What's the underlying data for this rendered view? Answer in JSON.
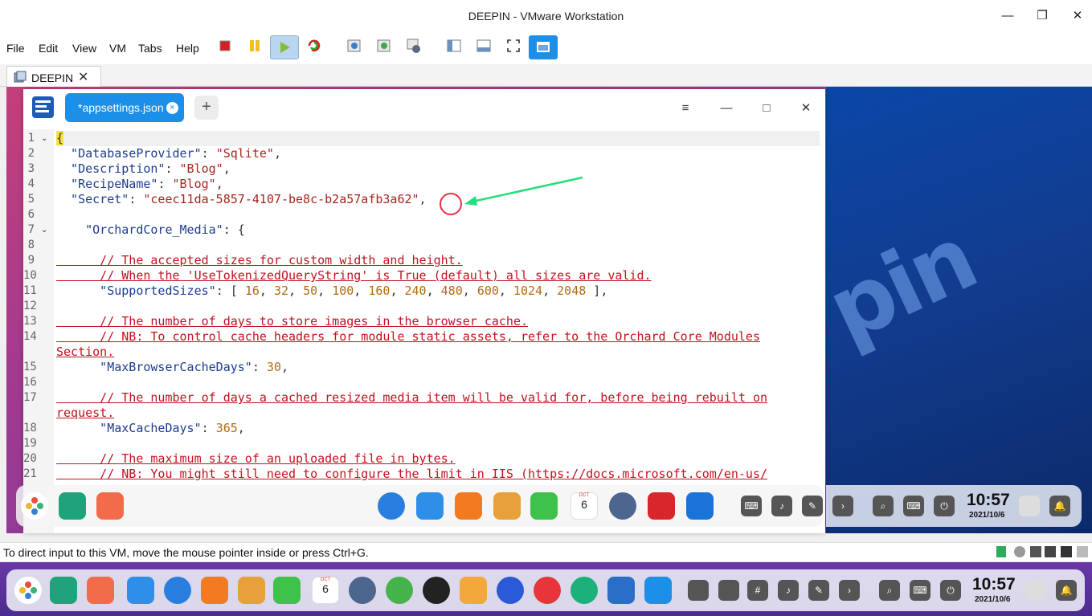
{
  "window": {
    "title": "DEEPIN - VMware Workstation",
    "minimize": "—",
    "restore": "❐",
    "close": "✕"
  },
  "menu": [
    "File",
    "Edit",
    "View",
    "VM",
    "Tabs",
    "Help"
  ],
  "toolbar": {
    "icons": [
      "power-icon",
      "pause-icon",
      "play-icon",
      "restart-icon",
      "snapshot-icon",
      "revert-snapshot-icon",
      "snapshot-manager-icon",
      "sidebar-icon",
      "console-view-icon",
      "fullscreen-icon",
      "unity-icon"
    ]
  },
  "vm_tab": {
    "label": "DEEPIN",
    "close": "✕"
  },
  "editor": {
    "tab_label": "*appsettings.json",
    "tab_close": "×",
    "add_tab": "+",
    "menu": "≡",
    "minimize": "—",
    "maximize": "□",
    "close": "✕",
    "line_numbers": [
      "1",
      "2",
      "3",
      "4",
      "5",
      "6",
      "7",
      "8",
      "9",
      "10",
      "11",
      "12",
      "13",
      "14",
      "",
      "15",
      "16",
      "17",
      "",
      "18",
      "19",
      "20",
      "21"
    ],
    "lines": [
      {
        "parts": [
          {
            "t": "{",
            "c": "p"
          }
        ]
      },
      {
        "parts": [
          {
            "t": "  \"DatabaseProvider\"",
            "c": "k"
          },
          {
            "t": ": ",
            "c": "p"
          },
          {
            "t": "\"Sqlite\"",
            "c": "s"
          },
          {
            "t": ",",
            "c": "p"
          }
        ]
      },
      {
        "parts": [
          {
            "t": "  \"Description\"",
            "c": "k"
          },
          {
            "t": ": ",
            "c": "p"
          },
          {
            "t": "\"Blog\"",
            "c": "s"
          },
          {
            "t": ",",
            "c": "p"
          }
        ]
      },
      {
        "parts": [
          {
            "t": "  \"RecipeName\"",
            "c": "k"
          },
          {
            "t": ": ",
            "c": "p"
          },
          {
            "t": "\"Blog\"",
            "c": "s"
          },
          {
            "t": ",",
            "c": "p"
          }
        ]
      },
      {
        "parts": [
          {
            "t": "  \"Secret\"",
            "c": "k"
          },
          {
            "t": ": ",
            "c": "p"
          },
          {
            "t": "\"ceec11da-5857-4107-be8c-b2a57afb3a62\"",
            "c": "s"
          },
          {
            "t": ",",
            "c": "p"
          }
        ]
      },
      {
        "parts": []
      },
      {
        "parts": [
          {
            "t": "    \"OrchardCore_Media\"",
            "c": "k"
          },
          {
            "t": ": {",
            "c": "p"
          }
        ]
      },
      {
        "parts": []
      },
      {
        "parts": [
          {
            "t": "      // The accepted sizes for custom width and height.",
            "c": "c"
          }
        ]
      },
      {
        "parts": [
          {
            "t": "      // When the 'UseTokenizedQueryString' is True (default) all sizes are valid.",
            "c": "c"
          }
        ]
      },
      {
        "parts": [
          {
            "t": "      \"SupportedSizes\"",
            "c": "k"
          },
          {
            "t": ": [ ",
            "c": "p"
          },
          {
            "t": "16",
            "c": "n"
          },
          {
            "t": ", ",
            "c": "p"
          },
          {
            "t": "32",
            "c": "n"
          },
          {
            "t": ", ",
            "c": "p"
          },
          {
            "t": "50",
            "c": "n"
          },
          {
            "t": ", ",
            "c": "p"
          },
          {
            "t": "100",
            "c": "n"
          },
          {
            "t": ", ",
            "c": "p"
          },
          {
            "t": "160",
            "c": "n"
          },
          {
            "t": ", ",
            "c": "p"
          },
          {
            "t": "240",
            "c": "n"
          },
          {
            "t": ", ",
            "c": "p"
          },
          {
            "t": "480",
            "c": "n"
          },
          {
            "t": ", ",
            "c": "p"
          },
          {
            "t": "600",
            "c": "n"
          },
          {
            "t": ", ",
            "c": "p"
          },
          {
            "t": "1024",
            "c": "n"
          },
          {
            "t": ", ",
            "c": "p"
          },
          {
            "t": "2048",
            "c": "n"
          },
          {
            "t": " ],",
            "c": "p"
          }
        ]
      },
      {
        "parts": []
      },
      {
        "parts": [
          {
            "t": "      // The number of days to store images in the browser cache.",
            "c": "c"
          }
        ]
      },
      {
        "parts": [
          {
            "t": "      // NB: To control cache headers for module static assets, refer to the Orchard Core Modules",
            "c": "c"
          }
        ]
      },
      {
        "parts": [
          {
            "t": "Section.",
            "c": "c"
          }
        ]
      },
      {
        "parts": [
          {
            "t": "      \"MaxBrowserCacheDays\"",
            "c": "k"
          },
          {
            "t": ": ",
            "c": "p"
          },
          {
            "t": "30",
            "c": "n"
          },
          {
            "t": ",",
            "c": "p"
          }
        ]
      },
      {
        "parts": []
      },
      {
        "parts": [
          {
            "t": "      // The number of days a cached resized media item will be valid for, before being rebuilt on",
            "c": "c"
          }
        ]
      },
      {
        "parts": [
          {
            "t": "request.",
            "c": "c"
          }
        ]
      },
      {
        "parts": [
          {
            "t": "      \"MaxCacheDays\"",
            "c": "k"
          },
          {
            "t": ": ",
            "c": "p"
          },
          {
            "t": "365",
            "c": "n"
          },
          {
            "t": ",",
            "c": "p"
          }
        ]
      },
      {
        "parts": []
      },
      {
        "parts": [
          {
            "t": "      // The maximum size of an uploaded file in bytes.",
            "c": "c"
          }
        ]
      },
      {
        "parts": [
          {
            "t": "      // NB: You might still need to configure the limit in IIS (https://docs.microsoft.com/en-us/",
            "c": "c"
          }
        ]
      }
    ]
  },
  "vm_dock": {
    "time": "10:57",
    "date": "2021/10/6",
    "calendar_month": "OCT",
    "calendar_day": "6"
  },
  "status": {
    "message": "To direct input to this VM, move the mouse pointer inside or press Ctrl+G."
  },
  "host_dock": {
    "time": "10:57",
    "date": "2021/10/6",
    "calendar_month": "OCT",
    "calendar_day": "6"
  },
  "colors": {
    "accent": "#1c8fe8",
    "arrow": "#22e07a",
    "circle": "#e5324a"
  }
}
